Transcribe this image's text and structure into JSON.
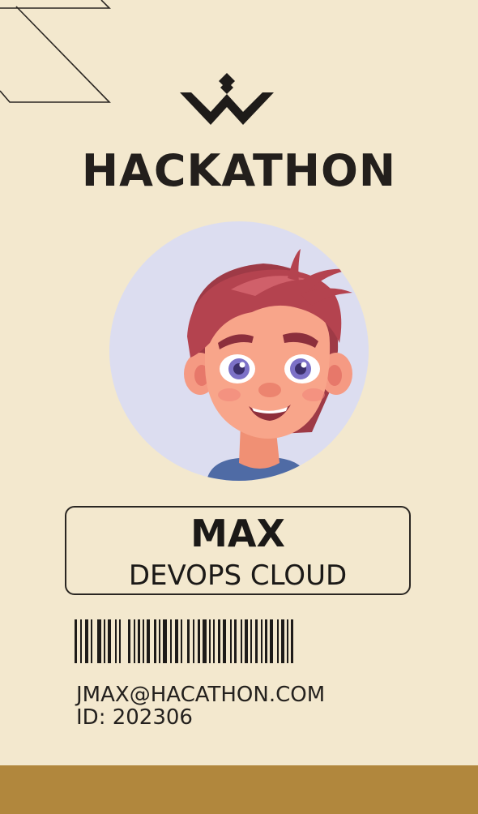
{
  "card": {
    "event_title": "HACKATHON",
    "name": "MAX",
    "role": "DEVOPS CLOUD",
    "email": "JMAX@HACATHON.COM",
    "id_line": "ID: 202306"
  },
  "icons": {
    "logo": "double-w-chevron-logo-icon",
    "avatar": "cartoon-boy-avatar",
    "barcode": "barcode"
  },
  "colors": {
    "background": "#F3E8CE",
    "text": "#231F1C",
    "footer_bar": "#B1873D",
    "avatar_bg": "#DCDDF0"
  }
}
